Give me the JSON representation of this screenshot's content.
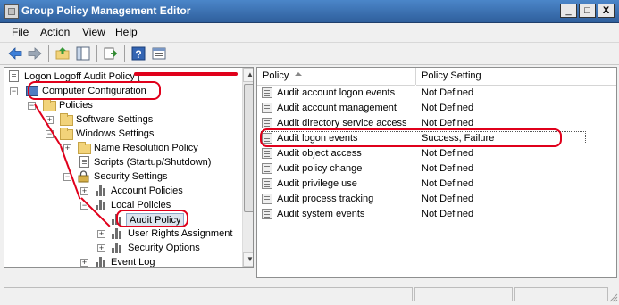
{
  "window": {
    "title": "Group Policy Management Editor",
    "minimize": "_",
    "maximize": "□",
    "close": "X"
  },
  "menu": {
    "file": "File",
    "action": "Action",
    "view": "View",
    "help": "Help"
  },
  "toolbar": {
    "buttons": [
      "back-icon",
      "forward-icon",
      "up-folder-icon",
      "show-hide-tree-icon",
      "export-list-icon",
      "help-icon",
      "properties-icon"
    ]
  },
  "tree": {
    "root": "Logon Logoff Audit Policy [",
    "items": [
      {
        "label": "Computer Configuration"
      },
      {
        "label": "Policies"
      },
      {
        "label": "Software Settings"
      },
      {
        "label": "Windows Settings"
      },
      {
        "label": "Name Resolution Policy"
      },
      {
        "label": "Scripts (Startup/Shutdown)"
      },
      {
        "label": "Security Settings"
      },
      {
        "label": "Account Policies"
      },
      {
        "label": "Local Policies"
      },
      {
        "label": "Audit Policy"
      },
      {
        "label": "User Rights Assignment"
      },
      {
        "label": "Security Options"
      },
      {
        "label": "Event Log"
      }
    ]
  },
  "list": {
    "columns": {
      "policy": "Policy",
      "setting": "Policy Setting"
    },
    "rows": [
      {
        "policy": "Audit account logon events",
        "setting": "Not Defined"
      },
      {
        "policy": "Audit account management",
        "setting": "Not Defined"
      },
      {
        "policy": "Audit directory service access",
        "setting": "Not Defined"
      },
      {
        "policy": "Audit logon events",
        "setting": "Success, Failure"
      },
      {
        "policy": "Audit object access",
        "setting": "Not Defined"
      },
      {
        "policy": "Audit policy change",
        "setting": "Not Defined"
      },
      {
        "policy": "Audit privilege use",
        "setting": "Not Defined"
      },
      {
        "policy": "Audit process tracking",
        "setting": "Not Defined"
      },
      {
        "policy": "Audit system events",
        "setting": "Not Defined"
      }
    ]
  },
  "colors": {
    "annotation": "#e0001b",
    "titlebar": "#3a6fb0"
  }
}
